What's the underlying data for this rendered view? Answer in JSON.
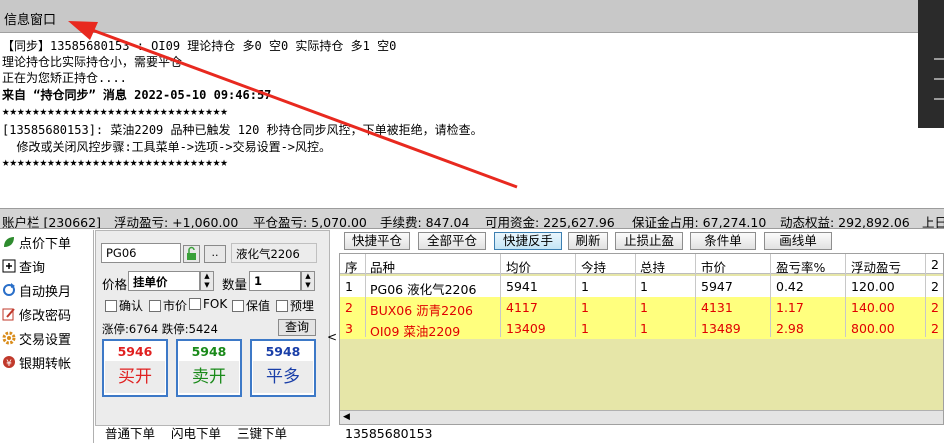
{
  "info_window": {
    "title": "信息窗口",
    "lines": [
      "【同步】13585680153 : OI09 理论持仓 多0 空0 实际持仓 多1 空0",
      "理论持仓比实际持仓小，需要平仓",
      "正在为您矫正持仓....",
      "来自 “持仓同步” 消息 2022-05-10 09:46:57",
      "★★★★★★★★★★★★★★★★★★★★★★★★★★★★★★",
      "[13585680153]: 菜油2209 品种已触发 120 秒持仓同步风控，下单被拒绝，请检查。",
      "  修改或关闭风控步骤:工具菜单->选项->交易设置->风控。",
      "★★★★★★★★★★★★★★★★★★★★★★★★★★★★★★"
    ]
  },
  "status_bar": {
    "account": "账户栏 [230662]",
    "float_pl": "浮动盈亏: +1,060.00",
    "close_pl": "平仓盈亏: 5,070.00",
    "fee": "手续费: 847.04",
    "available": "可用资金: 225,627.96",
    "margin": "保证金占用: 67,274.10",
    "equity": "动态权益: 292,892.06",
    "prev": "上日"
  },
  "left_nav": {
    "items": [
      {
        "label": "点价下单",
        "icon": "leaf-icon",
        "color": "#2e8b2e"
      },
      {
        "label": "查询",
        "icon": "plus-box-icon",
        "color": "#000000"
      },
      {
        "label": "自动换月",
        "icon": "refresh-icon",
        "color": "#2a6fc9"
      },
      {
        "label": "修改密码",
        "icon": "edit-icon",
        "color": "#c0392b"
      },
      {
        "label": "交易设置",
        "icon": "gear-icon",
        "color": "#d98c1a"
      },
      {
        "label": "银期转帐",
        "icon": "yen-icon",
        "color": "#c0392b"
      }
    ]
  },
  "order_panel": {
    "contract_code": "PG06",
    "contract_name": "液化气2206",
    "dots": "..",
    "price_label": "价格",
    "price_value": "挂单价",
    "qty_label": "数量",
    "qty_value": "1",
    "checks": [
      "确认",
      "市价",
      "FOK",
      "保值",
      "预埋"
    ],
    "limit_info": "涨停:6764 跌停:5424",
    "query_label": "查询",
    "buy": {
      "price": "5946",
      "label": "买开",
      "color": "#e02020"
    },
    "sell": {
      "price": "5948",
      "label": "卖开",
      "color": "#1a8a1a"
    },
    "close": {
      "price": "5948",
      "label": "平多",
      "color": "#1a3fa8"
    }
  },
  "bottom_tabs": [
    "普通下单",
    "闪电下单",
    "三键下单"
  ],
  "toolbar": {
    "buttons": [
      "快捷平仓",
      "全部平仓",
      "快捷反手",
      "刷新",
      "止损止盈",
      "条件单",
      "画线单"
    ],
    "active": "快捷反手"
  },
  "positions": {
    "columns": [
      "序",
      "品种",
      "均价",
      "今持",
      "总持",
      "市价",
      "盈亏率%",
      "浮动盈亏",
      "2"
    ],
    "rows": [
      {
        "seq": "1",
        "symbol": "PG06 液化气2206",
        "avg": "5941",
        "today": "1",
        "total": "1",
        "market": "5947",
        "rate": "0.42",
        "float": "120.00",
        "extra": "2",
        "style": "white"
      },
      {
        "seq": "2",
        "symbol": "BUX06 沥青2206",
        "avg": "4117",
        "today": "1",
        "total": "1",
        "market": "4131",
        "rate": "1.17",
        "float": "140.00",
        "extra": "2",
        "style": "yellow red"
      },
      {
        "seq": "3",
        "symbol": "OI09 菜油2209",
        "avg": "13409",
        "today": "1",
        "total": "1",
        "market": "13489",
        "rate": "2.98",
        "float": "800.00",
        "extra": "2",
        "style": "yellow red"
      }
    ]
  },
  "footer": {
    "account": "13585680153"
  },
  "colors": {
    "arrow": "#e8291f",
    "active_border": "#3c7fb1"
  }
}
